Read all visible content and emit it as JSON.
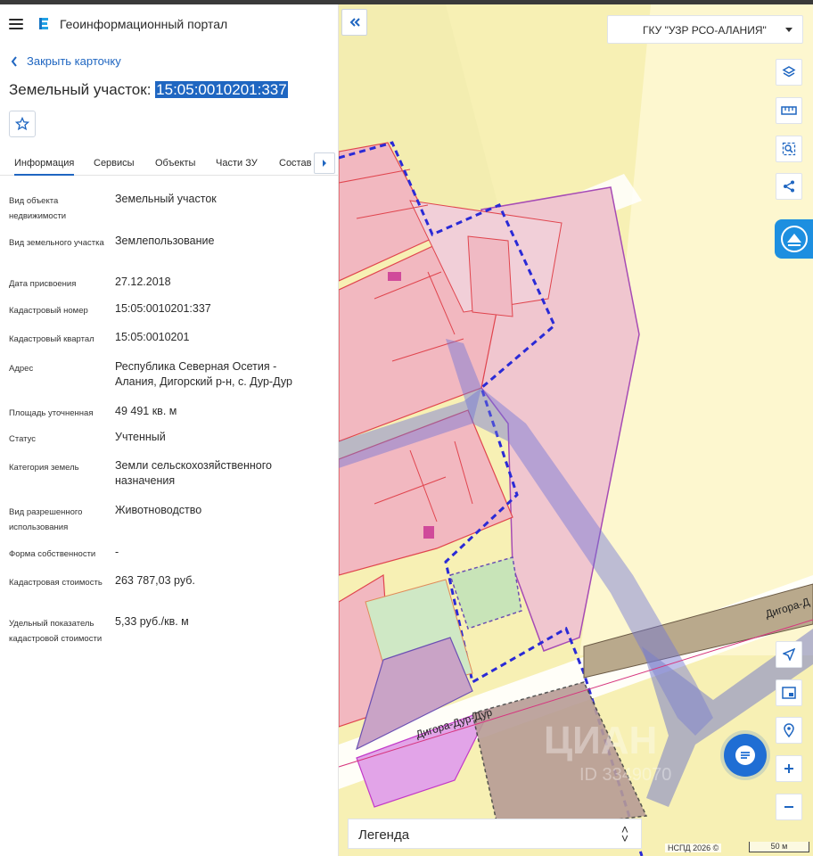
{
  "header": {
    "title": "Геоинформационный портал"
  },
  "card": {
    "back_label": "Закрыть карточку",
    "title_prefix": "Земельный участок: ",
    "cadastral_number": "15:05:0010201:337"
  },
  "tabs": [
    {
      "label": "Информация",
      "active": true
    },
    {
      "label": "Сервисы"
    },
    {
      "label": "Объекты"
    },
    {
      "label": "Части ЗУ"
    },
    {
      "label": "Состав"
    }
  ],
  "info": [
    {
      "label": "Вид объекта недвижимости",
      "value": "Земельный участок"
    },
    {
      "label": "Вид земельного участка",
      "value": "Землепользование"
    },
    {
      "label": "Дата присвоения",
      "value": "27.12.2018"
    },
    {
      "label": "Кадастровый номер",
      "value": "15:05:0010201:337"
    },
    {
      "label": "Кадастровый квартал",
      "value": "15:05:0010201"
    },
    {
      "label": "Адрес",
      "value": "Республика Северная Осетия - Алания, Дигорский р-н, с. Дур-Дур"
    },
    {
      "label": "Площадь уточненная",
      "value": "49 491 кв. м"
    },
    {
      "label": "Статус",
      "value": "Учтенный"
    },
    {
      "label": "Категория земель",
      "value": "Земли сельскохозяйственного назначения"
    },
    {
      "label": "Вид разрешенного использования",
      "value": "Животноводство"
    },
    {
      "label": "Форма собственности",
      "value": "-"
    },
    {
      "label": "Кадастровая стоимость",
      "value": "263 787,03 руб."
    },
    {
      "label": "Удельный показатель кадастровой стоимости",
      "value": "5,33 руб./кв. м"
    }
  ],
  "map": {
    "organization": "ГКУ \"УЗР РСО-АЛАНИЯ\"",
    "road_label_1": "Дигора-Дур-Дур",
    "road_label_2": "Дигора-Д",
    "watermark": "ЦИАН",
    "watermark_id": "ID 3349070",
    "legend_label": "Легенда",
    "copyright": "НСПД 2026 ©",
    "scale_label": "50 м"
  },
  "colors": {
    "accent": "#1f66c1",
    "map_bg": "#f7f0b4",
    "parcel_fill": "#f0bcc3",
    "parcel_stroke": "#e0454e",
    "selected_stroke": "#2a2ad6"
  }
}
